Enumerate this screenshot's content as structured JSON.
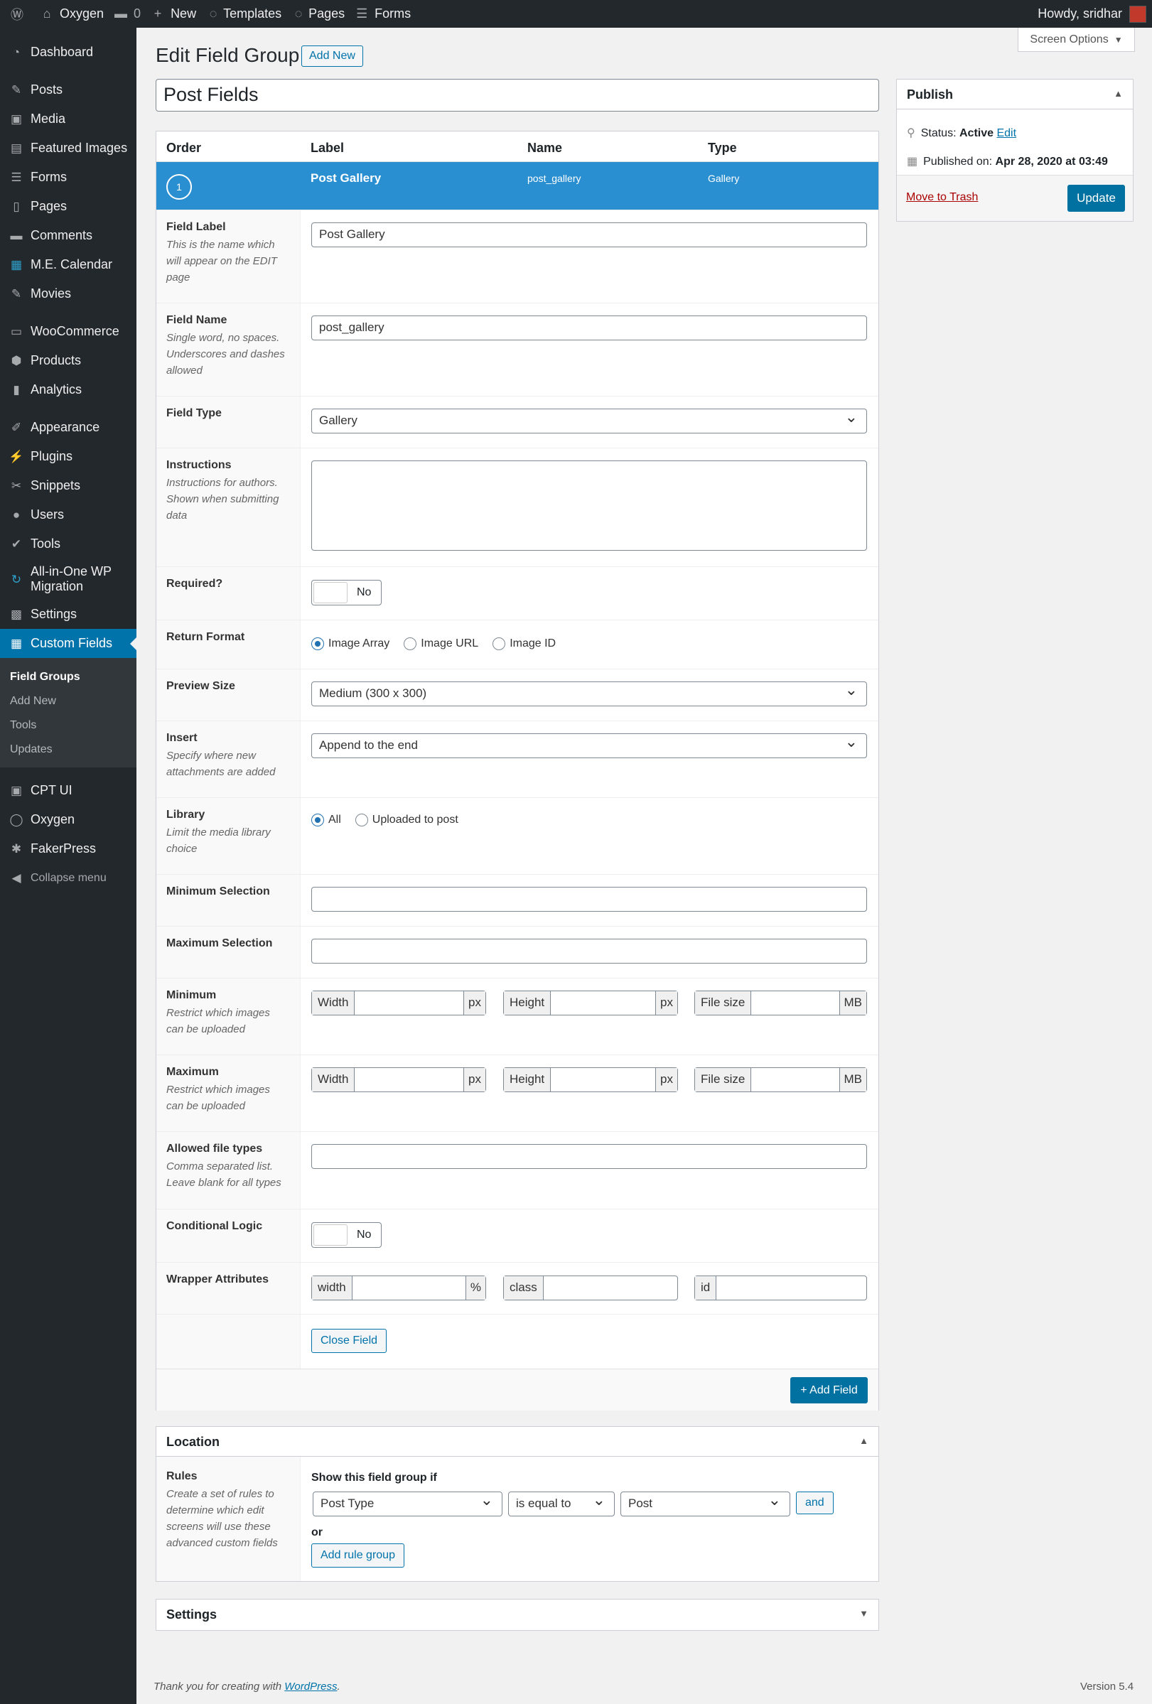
{
  "adminbar": {
    "site": "Oxygen",
    "comments": "0",
    "new": "New",
    "templates": "Templates",
    "pages": "Pages",
    "forms": "Forms",
    "howdy": "Howdy, sridhar"
  },
  "sidebar": {
    "items": [
      {
        "label": "Dashboard",
        "icon": "dashboard-icon"
      },
      {
        "label": "Posts",
        "icon": "pin-icon"
      },
      {
        "label": "Media",
        "icon": "media-icon"
      },
      {
        "label": "Featured Images",
        "icon": "images-icon"
      },
      {
        "label": "Forms",
        "icon": "forms-icon"
      },
      {
        "label": "Pages",
        "icon": "pages-icon"
      },
      {
        "label": "Comments",
        "icon": "comments-icon"
      },
      {
        "label": "M.E. Calendar",
        "icon": "calendar-icon"
      },
      {
        "label": "Movies",
        "icon": "pin-icon"
      },
      {
        "label": "WooCommerce",
        "icon": "woo-icon"
      },
      {
        "label": "Products",
        "icon": "products-icon"
      },
      {
        "label": "Analytics",
        "icon": "analytics-icon"
      },
      {
        "label": "Appearance",
        "icon": "brush-icon"
      },
      {
        "label": "Plugins",
        "icon": "plugin-icon"
      },
      {
        "label": "Snippets",
        "icon": "snippets-icon"
      },
      {
        "label": "Users",
        "icon": "users-icon"
      },
      {
        "label": "Tools",
        "icon": "tools-icon"
      },
      {
        "label": "All-in-One WP Migration",
        "icon": "migration-icon"
      },
      {
        "label": "Settings",
        "icon": "settings-icon"
      },
      {
        "label": "Custom Fields",
        "icon": "custom-fields-icon"
      }
    ],
    "submenu": [
      "Field Groups",
      "Add New",
      "Tools",
      "Updates"
    ],
    "lower": [
      {
        "label": "CPT UI",
        "icon": "cpt-icon"
      },
      {
        "label": "Oxygen",
        "icon": "oxygen-icon"
      },
      {
        "label": "FakerPress",
        "icon": "faker-icon"
      }
    ],
    "collapse": "Collapse menu"
  },
  "header": {
    "title": "Edit Field Group",
    "add_new": "Add New",
    "screen_options": "Screen Options"
  },
  "group_title": "Post Fields",
  "table": {
    "cols": [
      "Order",
      "Label",
      "Name",
      "Type"
    ],
    "row": {
      "order": "1",
      "label": "Post Gallery",
      "name": "post_gallery",
      "type": "Gallery"
    }
  },
  "fields": {
    "label": {
      "t": "Field Label",
      "d": "This is the name which will appear on the EDIT page",
      "v": "Post Gallery"
    },
    "name": {
      "t": "Field Name",
      "d": "Single word, no spaces. Underscores and dashes allowed",
      "v": "post_gallery"
    },
    "type": {
      "t": "Field Type",
      "v": "Gallery"
    },
    "instructions": {
      "t": "Instructions",
      "d": "Instructions for authors. Shown when submitting data"
    },
    "required": {
      "t": "Required?",
      "v": "No"
    },
    "return_format": {
      "t": "Return Format",
      "opts": [
        "Image Array",
        "Image URL",
        "Image ID"
      ]
    },
    "preview_size": {
      "t": "Preview Size",
      "v": "Medium (300 x 300)"
    },
    "insert": {
      "t": "Insert",
      "d": "Specify where new attachments are added",
      "v": "Append to the end"
    },
    "library": {
      "t": "Library",
      "d": "Limit the media library choice",
      "opts": [
        "All",
        "Uploaded to post"
      ]
    },
    "min_sel": {
      "t": "Minimum Selection"
    },
    "max_sel": {
      "t": "Maximum Selection"
    },
    "minimum": {
      "t": "Minimum",
      "d": "Restrict which images can be uploaded"
    },
    "maximum": {
      "t": "Maximum",
      "d": "Restrict which images can be uploaded"
    },
    "dims": {
      "width": "Width",
      "height": "Height",
      "filesize": "File size",
      "px": "px",
      "mb": "MB"
    },
    "allowed": {
      "t": "Allowed file types",
      "d": "Comma separated list. Leave blank for all types"
    },
    "conditional": {
      "t": "Conditional Logic",
      "v": "No"
    },
    "wrapper": {
      "t": "Wrapper Attributes",
      "width": "width",
      "pct": "%",
      "cls": "class",
      "id": "id"
    },
    "close": "Close Field",
    "add_field": "+ Add Field"
  },
  "publish": {
    "title": "Publish",
    "status_label": "Status:",
    "status": "Active",
    "edit": "Edit",
    "published_label": "Published on:",
    "published": "Apr 28, 2020 at 03:49",
    "trash": "Move to Trash",
    "update": "Update"
  },
  "location": {
    "title": "Location",
    "rules_t": "Rules",
    "rules_d": "Create a set of rules to determine which edit screens will use these advanced custom fields",
    "show_if": "Show this field group if",
    "param": "Post Type",
    "operator": "is equal to",
    "value": "Post",
    "and": "and",
    "or": "or",
    "add_rule": "Add rule group"
  },
  "settings_box": {
    "title": "Settings"
  },
  "footer": {
    "thanks": "Thank you for creating with",
    "wp": "WordPress",
    "version": "Version 5.4"
  }
}
